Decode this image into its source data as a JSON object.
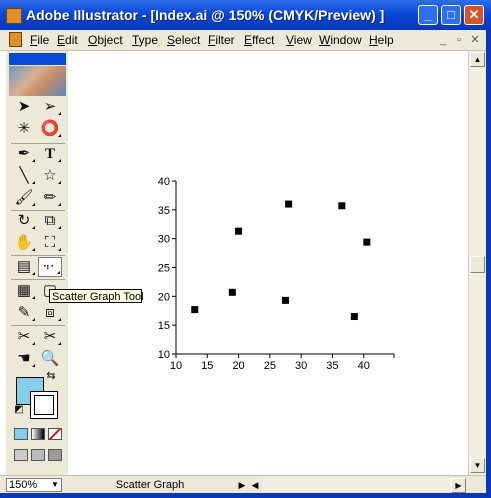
{
  "window": {
    "title": "Adobe Illustrator - [Index.ai @ 150% (CMYK/Preview) ]",
    "min": "_",
    "max": "□",
    "close": "✕"
  },
  "menu": {
    "items": [
      "File",
      "Edit",
      "Object",
      "Type",
      "Select",
      "Filter",
      "Effect",
      "View",
      "Window",
      "Help"
    ],
    "mdi": [
      "_",
      "▫",
      "✕"
    ]
  },
  "tooltip": "Scatter Graph Tool",
  "status": {
    "zoom": "150%",
    "tool": "Scatter Graph"
  },
  "chart_data": {
    "type": "scatter",
    "x_ticks": [
      "10",
      "15",
      "20",
      "25",
      "30",
      "35",
      "40"
    ],
    "y_ticks": [
      "10",
      "15",
      "20",
      "25",
      "30",
      "35",
      "40"
    ],
    "xlim": [
      10,
      45
    ],
    "ylim": [
      10,
      40
    ],
    "points": [
      {
        "x": 13.0,
        "y": 17.7
      },
      {
        "x": 19.0,
        "y": 20.7
      },
      {
        "x": 20.0,
        "y": 31.3
      },
      {
        "x": 27.5,
        "y": 19.3
      },
      {
        "x": 28.0,
        "y": 36.0
      },
      {
        "x": 36.5,
        "y": 35.7
      },
      {
        "x": 38.5,
        "y": 16.5
      },
      {
        "x": 40.5,
        "y": 29.4
      }
    ]
  }
}
